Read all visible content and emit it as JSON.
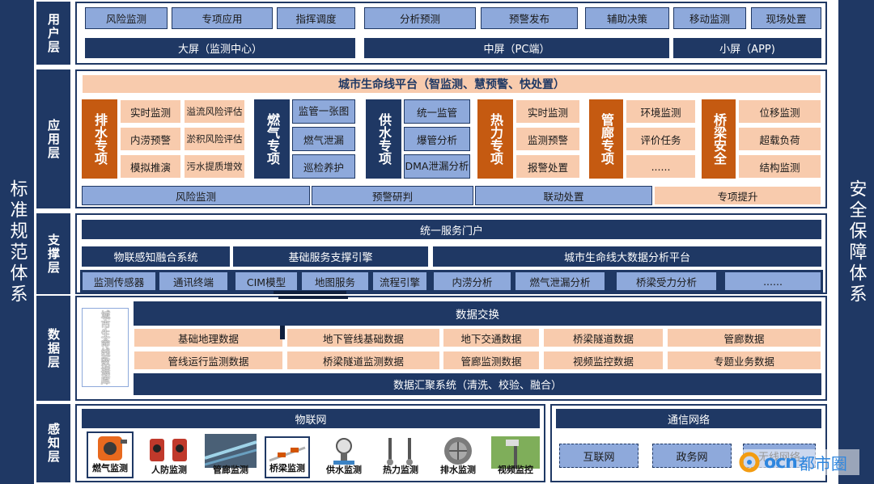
{
  "left_title": "标准规范体系",
  "right_title": "安全保障体系",
  "layers": {
    "user": "用户层",
    "app": "应用层",
    "support": "支撑层",
    "data": "数据层",
    "sense": "感知层"
  },
  "user_layer": {
    "row1": [
      "风险监测",
      "专项应用",
      "指挥调度",
      "分析预测",
      "预警发布",
      "辅助决策",
      "移动监测",
      "现场处置"
    ],
    "screens": [
      "大屏（监测中心）",
      "中屏（PC端）",
      "小屏（APP)"
    ]
  },
  "app_layer": {
    "platform": "城市生命线平台（智监测、慧预警、快处置）",
    "drainage": {
      "title": "排水专项",
      "items": [
        "实时监测",
        "溢流风险评估",
        "内涝预警",
        "淤积风险评估",
        "模拟推演",
        "污水提质增效"
      ]
    },
    "gas": {
      "title": "燃气专项",
      "items": [
        "监管一张图",
        "燃气泄漏",
        "巡检养护"
      ]
    },
    "water": {
      "title": "供水专项",
      "items": [
        "统一监管",
        "爆管分析",
        "DMA泄漏分析"
      ]
    },
    "heat": {
      "title": "热力专项",
      "items": [
        "实时监测",
        "监测预警",
        "报警处置"
      ]
    },
    "corridor": {
      "title": "管廊专项",
      "items": [
        "环境监测",
        "评价任务",
        "......"
      ]
    },
    "bridge": {
      "title": "桥梁安全",
      "items": [
        "位移监测",
        "超载负荷",
        "结构监测"
      ]
    },
    "bottom": [
      "风险监测",
      "预警研判",
      "联动处置",
      "专项提升"
    ]
  },
  "support_layer": {
    "portal": "统一服务门户",
    "engines": [
      "物联感知融合系统",
      "基础服务支撑引擎",
      "城市生命线大数据分析平台"
    ],
    "services": [
      "监测传感器",
      "通讯终端",
      "CIM模型",
      "地图服务",
      "流程引擎",
      "内涝分析",
      "燃气泄漏分析",
      "桥梁受力分析",
      "......"
    ]
  },
  "data_layer": {
    "side_label": "城市生命线数据库",
    "exchange": "数据交换",
    "row1": [
      "基础地理数据",
      "地下管线基础数据",
      "地下交通数据",
      "桥梁隧道数据",
      "管廊数据"
    ],
    "row2": [
      "管线运行监测数据",
      "桥梁隧道监测数据",
      "管廊监测数据",
      "视频监控数据",
      "专题业务数据"
    ],
    "aggregation": "数据汇聚系统（清洗、校验、融合）"
  },
  "sense_layer": {
    "iot": "物联网",
    "sensors": [
      "燃气监测",
      "人防监测",
      "管廊监测",
      "桥梁监测",
      "供水监测",
      "热力监测",
      "排水监测",
      "视频监控"
    ],
    "network": "通信网络",
    "nets": [
      "互联网",
      "政务网",
      "无线网络"
    ]
  },
  "watermark": {
    "text": "都市圈",
    "mark": "ocn"
  }
}
